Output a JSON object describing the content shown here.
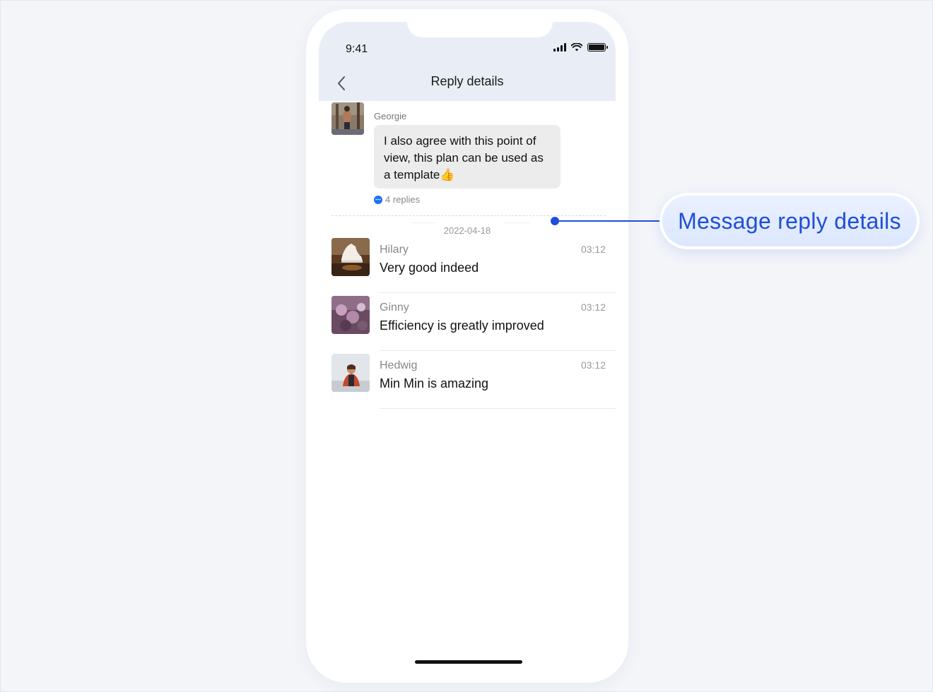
{
  "status_bar": {
    "time": "9:41"
  },
  "header": {
    "title": "Reply details"
  },
  "original_message": {
    "author": "Georgie",
    "text": "I also agree with this point of view, this plan can be used as a template👍",
    "replies_label": "4 replies"
  },
  "date_separator": "2022-04-18",
  "replies": [
    {
      "name": "Hilary",
      "text": "Very good indeed",
      "time": "03:12"
    },
    {
      "name": "Ginny",
      "text": "Efficiency is greatly improved",
      "time": "03:12"
    },
    {
      "name": "Hedwig",
      "text": "Min Min is amazing",
      "time": "03:12"
    }
  ],
  "callout": {
    "label": "Message reply details"
  },
  "colors": {
    "accent": "#1f4fd6",
    "link_blue": "#1e6ef5",
    "header_bg": "#e9eef6",
    "bubble_bg": "#ececec"
  }
}
